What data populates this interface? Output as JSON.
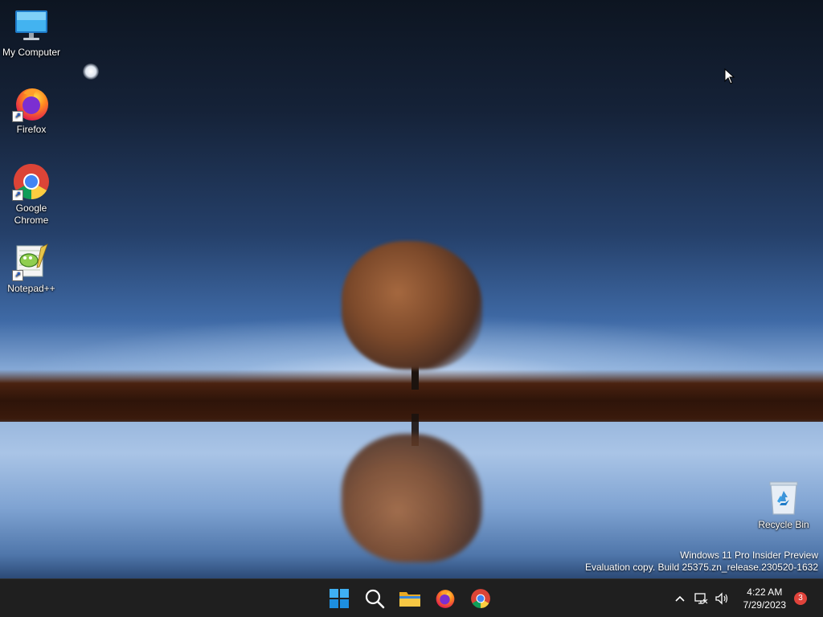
{
  "desktop": {
    "icons": [
      {
        "label": "My Computer",
        "icon": "monitor-icon",
        "shortcut": false
      },
      {
        "label": "Firefox",
        "icon": "firefox-icon",
        "shortcut": true
      },
      {
        "label": "Google\nChrome",
        "icon": "chrome-icon",
        "shortcut": true
      },
      {
        "label": "Notepad++",
        "icon": "notepadpp-icon",
        "shortcut": true
      },
      {
        "label": "Recycle Bin",
        "icon": "recycle-bin-icon",
        "shortcut": false
      }
    ],
    "watermark": {
      "line1": "Windows 11 Pro Insider Preview",
      "line2": "Evaluation copy. Build 25375.zn_release.230520-1632"
    }
  },
  "taskbar": {
    "apps": [
      {
        "name": "start",
        "icon": "windows-logo-icon"
      },
      {
        "name": "search",
        "icon": "search-icon"
      },
      {
        "name": "file-explorer",
        "icon": "folder-icon"
      },
      {
        "name": "firefox",
        "icon": "firefox-icon"
      },
      {
        "name": "chrome",
        "icon": "chrome-icon"
      }
    ],
    "tray": {
      "time": "4:22 AM",
      "date": "7/29/2023",
      "notification_count": "3"
    }
  },
  "colors": {
    "taskbar_bg": "#1f1f1f",
    "badge": "#e0433b",
    "accent": "#0078d4"
  }
}
